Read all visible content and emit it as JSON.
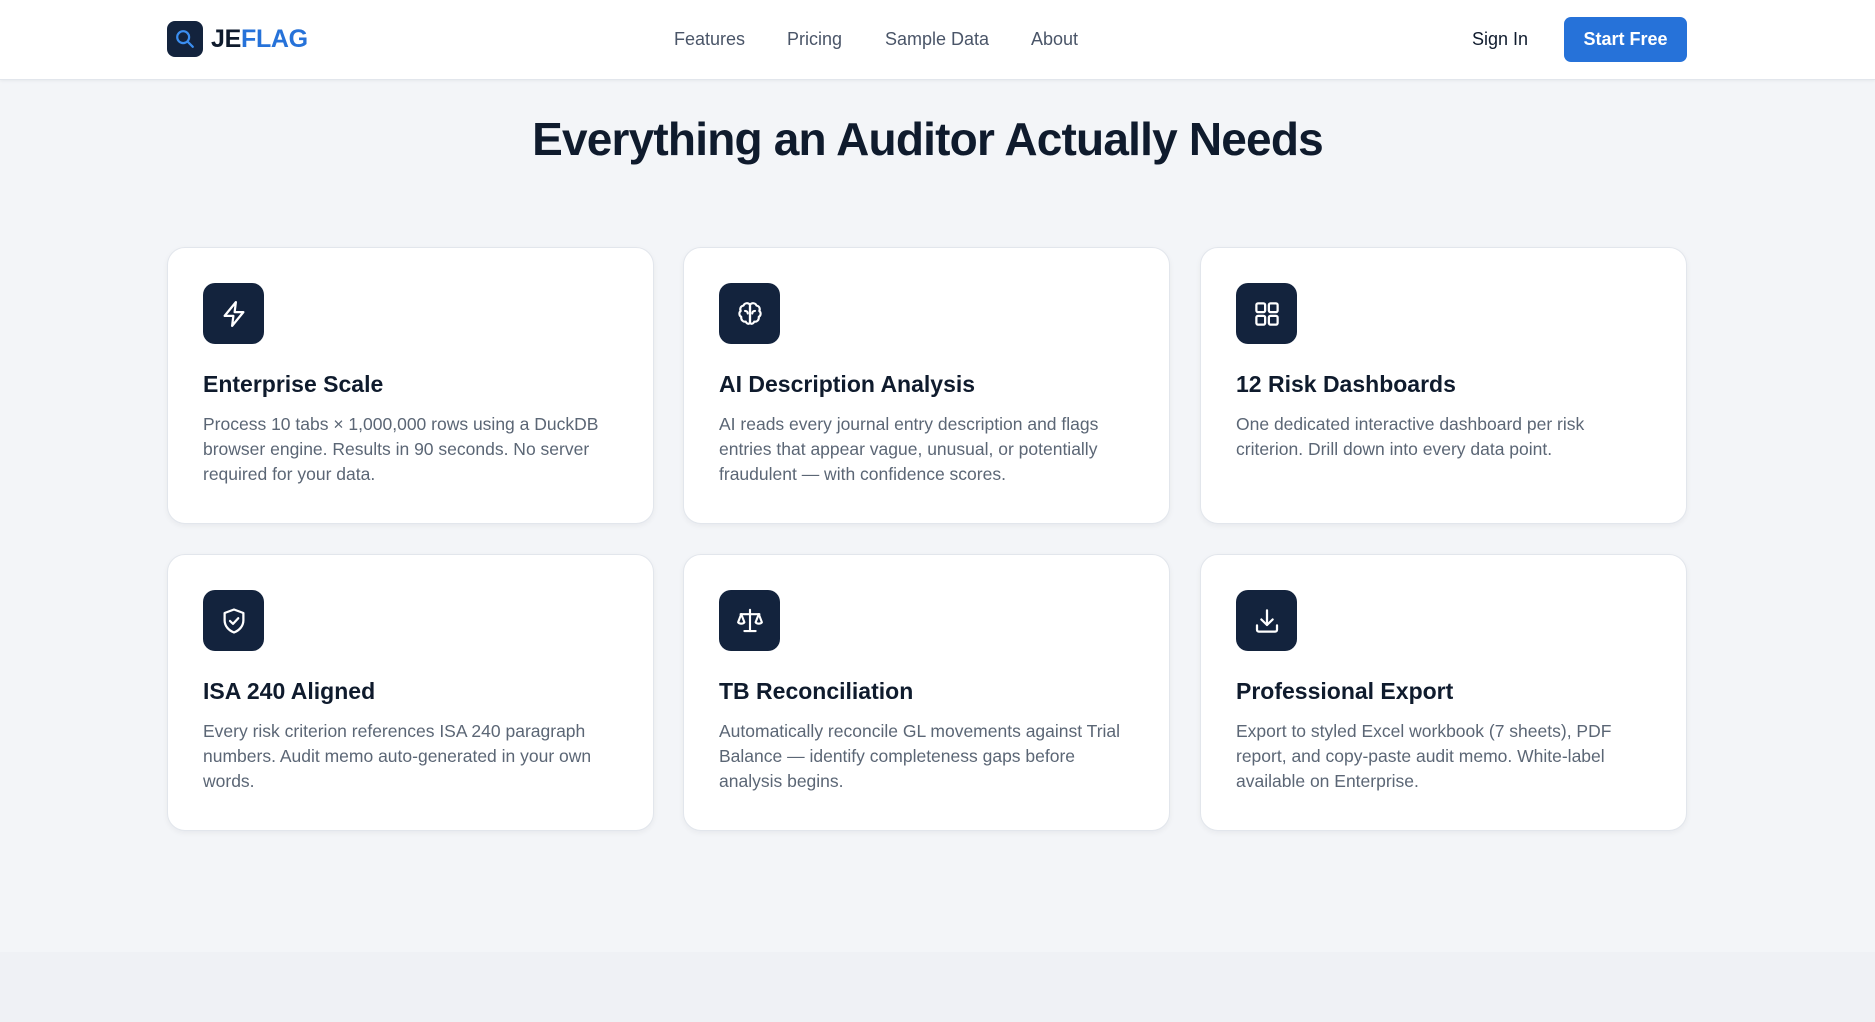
{
  "brand": {
    "prefix": "JE",
    "suffix": "FLAG",
    "logo_icon": "magnifier-icon"
  },
  "nav": {
    "links": [
      "Features",
      "Pricing",
      "Sample Data",
      "About"
    ],
    "sign_in": "Sign In",
    "cta": "Start Free"
  },
  "section": {
    "title": "Everything an Auditor Actually Needs",
    "features": [
      {
        "icon": "lightning-icon",
        "title": "Enterprise Scale",
        "description": "Process 10 tabs × 1,000,000 rows using a DuckDB browser engine. Results in 90 seconds. No server required for your data."
      },
      {
        "icon": "brain-icon",
        "title": "AI Description Analysis",
        "description": "AI reads every journal entry description and flags entries that appear vague, unusual, or potentially fraudulent — with confidence scores."
      },
      {
        "icon": "grid-icon",
        "title": "12 Risk Dashboards",
        "description": "One dedicated interactive dashboard per risk criterion. Drill down into every data point."
      },
      {
        "icon": "shield-check-icon",
        "title": "ISA 240 Aligned",
        "description": "Every risk criterion references ISA 240 paragraph numbers. Audit memo auto-generated in your own words."
      },
      {
        "icon": "scale-icon",
        "title": "TB Reconciliation",
        "description": "Automatically reconcile GL movements against Trial Balance — identify completeness gaps before analysis begins."
      },
      {
        "icon": "download-icon",
        "title": "Professional Export",
        "description": "Export to styled Excel workbook (7 sheets), PDF report, and copy-paste audit memo. White-label available on Enterprise."
      }
    ]
  },
  "colors": {
    "primary": "#2672d9",
    "navy": "#13233d",
    "text": "#0f1b2d",
    "muted": "#5b6675",
    "background": "#f3f5f8"
  }
}
